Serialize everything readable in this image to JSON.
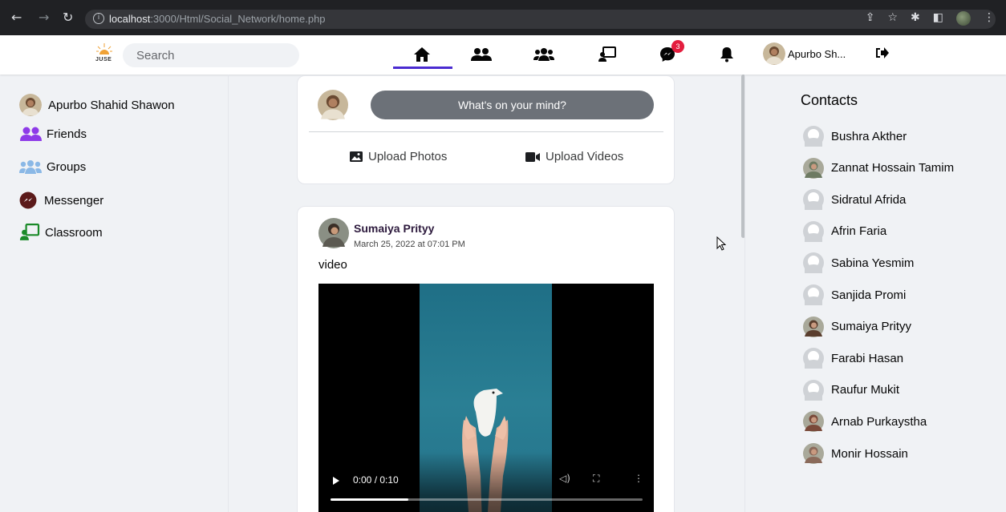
{
  "browser": {
    "url_host": "localhost",
    "url_rest": ":3000/Html/Social_Network/home.php"
  },
  "header": {
    "logo_text": "JUSE",
    "search_placeholder": "Search",
    "nav_icons": [
      "home-icon",
      "friends-icon",
      "groups-icon",
      "classroom-icon",
      "messenger-icon",
      "bell-icon"
    ],
    "messenger_badge": "3",
    "user_short_name": "Apurbo Sh...",
    "accent_color": "#4a2bd1"
  },
  "sidebar": {
    "items": [
      {
        "label": "Apurbo Shahid Shawon",
        "icon": "avatar"
      },
      {
        "label": "Friends",
        "icon": "friends-icon"
      },
      {
        "label": "Groups",
        "icon": "groups-icon"
      },
      {
        "label": "Messenger",
        "icon": "messenger-icon"
      },
      {
        "label": "Classroom",
        "icon": "classroom-icon"
      }
    ]
  },
  "composer": {
    "prompt": "What's on your mind?",
    "upload_photos": "Upload Photos",
    "upload_videos": "Upload Videos"
  },
  "post": {
    "author": "Sumaiya Prityy",
    "timestamp": "March 25, 2022 at 07:01 PM",
    "text": "video",
    "video_time": "0:00 / 0:10",
    "progress": 0.25
  },
  "contacts": {
    "title": "Contacts",
    "list": [
      {
        "name": "Bushra Akther",
        "photo": false
      },
      {
        "name": "Zannat Hossain Tamim",
        "photo": true
      },
      {
        "name": "Sidratul Afrida",
        "photo": false
      },
      {
        "name": "Afrin Faria",
        "photo": false
      },
      {
        "name": "Sabina Yesmim",
        "photo": false
      },
      {
        "name": "Sanjida Promi",
        "photo": false
      },
      {
        "name": "Sumaiya Prityy",
        "photo": true
      },
      {
        "name": "Farabi Hasan",
        "photo": false
      },
      {
        "name": "Raufur Mukit",
        "photo": false
      },
      {
        "name": "Arnab Purkaystha",
        "photo": true
      },
      {
        "name": "Monir Hossain",
        "photo": true
      }
    ]
  }
}
